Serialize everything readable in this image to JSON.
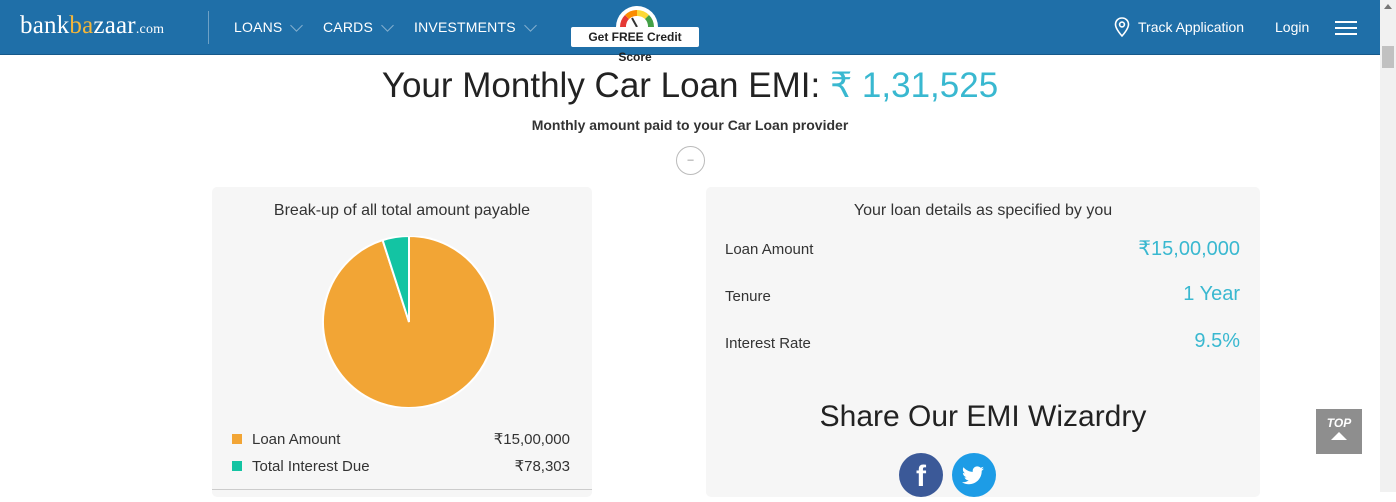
{
  "header": {
    "logo": {
      "part1": "bank",
      "part2": "ba",
      "part3": "zaar",
      "part4": ".com"
    },
    "nav": [
      {
        "label": "LOANS"
      },
      {
        "label": "CARDS"
      },
      {
        "label": "INVESTMENTS"
      }
    ],
    "credit_score_label": "Get FREE Credit Score",
    "track_label": "Track Application",
    "login_label": "Login"
  },
  "main": {
    "headline_prefix": "Your Monthly Car Loan EMI:",
    "headline_amount": "₹ 1,31,525",
    "subtitle": "Monthly amount paid to your Car Loan provider",
    "toggle_label": "–"
  },
  "breakup": {
    "title": "Break-up of all total amount payable",
    "legend": [
      {
        "label": "Loan Amount",
        "value": "₹15,00,000",
        "color": "#f2a535"
      },
      {
        "label": "Total Interest Due",
        "value": "₹78,303",
        "color": "#13c4a3"
      }
    ]
  },
  "chart_data": {
    "type": "pie",
    "labels": [
      "Loan Amount",
      "Total Interest Due"
    ],
    "values": [
      1500000,
      78303
    ],
    "colors": [
      "#f2a535",
      "#13c4a3"
    ]
  },
  "details": {
    "title": "Your loan details as specified by you",
    "rows": [
      {
        "label": "Loan Amount",
        "value": "₹15,00,000"
      },
      {
        "label": "Tenure",
        "value": "1 Year"
      },
      {
        "label": "Interest Rate",
        "value": "9.5%"
      }
    ]
  },
  "share": {
    "title": "Share Our EMI Wizardry",
    "facebook_glyph": "f"
  },
  "top_button": {
    "label": "TOP"
  },
  "colors": {
    "header": "#1f6fa8",
    "accent": "#39b8d0"
  }
}
